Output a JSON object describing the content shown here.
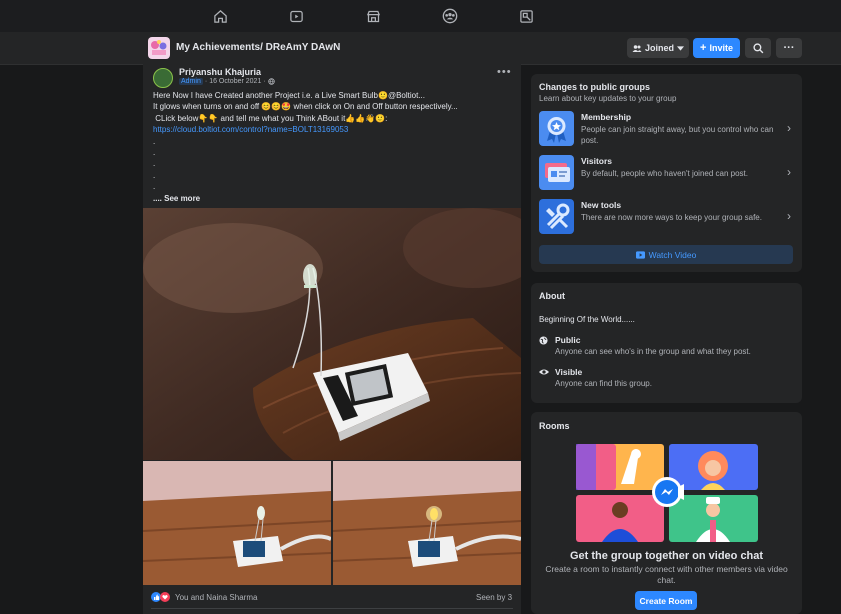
{
  "colors": {
    "background": "#18191a",
    "surface": "#242526",
    "accent": "#2d88ff",
    "text_primary": "#e4e6eb",
    "text_secondary": "#b0b3b8",
    "link": "#4599ff"
  },
  "top_nav": {
    "icons": [
      "home-icon",
      "watch-icon",
      "marketplace-icon",
      "groups-icon",
      "gaming-icon"
    ]
  },
  "group_header": {
    "title": "My Achievements/ DReAmY DAwN",
    "joined_label": "Joined",
    "invite_label": "Invite",
    "search_icon": "search-icon",
    "more_label": "···"
  },
  "post": {
    "author": "Priyanshu Khajuria",
    "badge": "Admin",
    "date": "16 October 2021",
    "lines": [
      "Here Now I have Created another Project i.e. a Live Smart Bulb🙂@Boltiot...",
      "It glows when turns on and off 😊😊🤩 when click on On and Off button respectively...",
      " CLick below👇👇 and tell me what you Think ABout it👍👍👋🙂:"
    ],
    "link": "https://cloud.boltiot.com/control?name=BOLT13169053",
    "dots": [
      ".",
      ".",
      ".",
      ".",
      "."
    ],
    "see_more": ".... See more",
    "reactions_text": "You and Naina Sharma",
    "seen_text": "Seen by 3"
  },
  "changes_card": {
    "title": "Changes to public groups",
    "subtitle": "Learn about key updates to your group",
    "items": [
      {
        "name": "Membership",
        "desc": "People can join straight away, but you control who can post.",
        "icon": "membership-badge-icon"
      },
      {
        "name": "Visitors",
        "desc": "By default, people who haven't joined can post.",
        "icon": "visitors-card-icon"
      },
      {
        "name": "New tools",
        "desc": "There are now more ways to keep your group safe.",
        "icon": "tools-icon"
      }
    ],
    "watch_label": "Watch Video"
  },
  "about_card": {
    "title": "About",
    "description": "Beginning Of the World......",
    "public_title": "Public",
    "public_desc": "Anyone can see who's in the group and what they post.",
    "visible_title": "Visible",
    "visible_desc": "Anyone can find this group."
  },
  "rooms_card": {
    "title": "Rooms",
    "heading": "Get the group together on video chat",
    "desc": "Create a room to instantly connect with other members via video chat.",
    "button_label": "Create Room"
  }
}
